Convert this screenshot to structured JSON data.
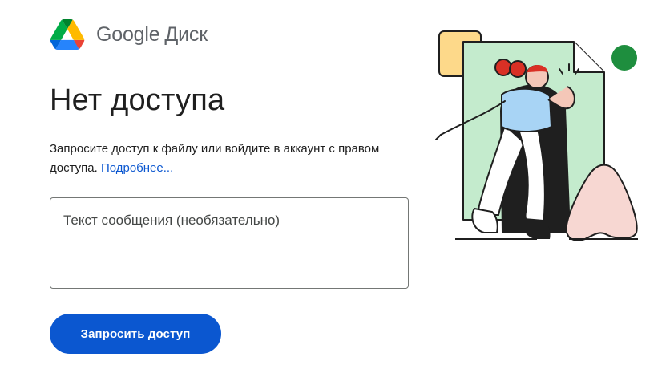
{
  "brand": {
    "company": "Google",
    "product": "Диск",
    "logo_icon": "google-drive-logo",
    "colors": {
      "green": "#1ea362",
      "yellow": "#ffba00",
      "blue": "#2684fc",
      "red": "#ea4335"
    }
  },
  "main": {
    "title": "Нет доступа",
    "description": "Запросите доступ к файлу или войдите в аккаунт с правом доступа. ",
    "learn_more": "Подробнее...",
    "message_placeholder": "Текст сообщения (необязательно)",
    "request_button": "Запросить доступ"
  },
  "theme": {
    "accent": "#0b57d0",
    "text": "#1f1f1f",
    "muted": "#5f6368"
  }
}
